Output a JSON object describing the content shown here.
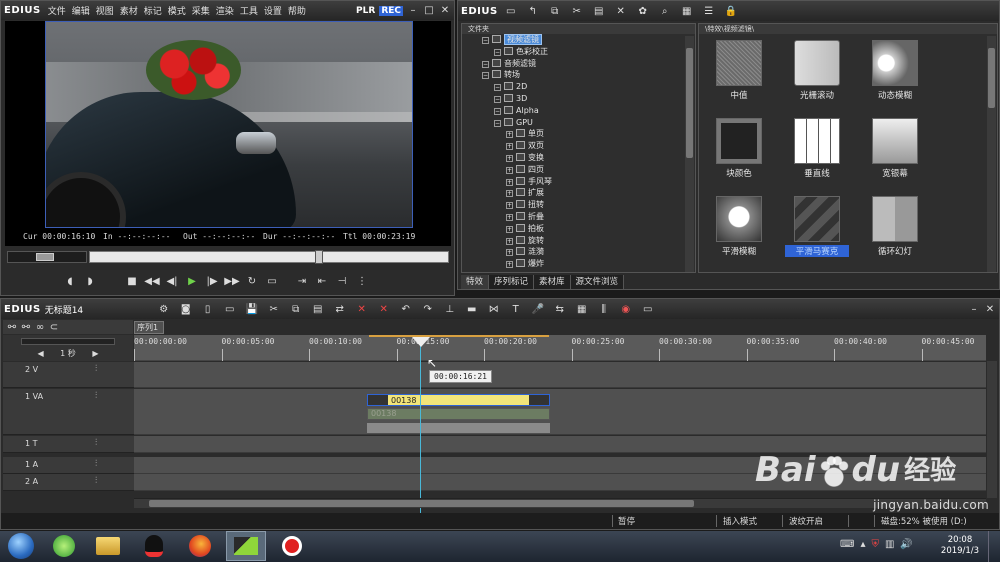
{
  "player": {
    "logo": "EDIUS",
    "menu": [
      "文件",
      "编辑",
      "视图",
      "素材",
      "标记",
      "模式",
      "采集",
      "渲染",
      "工具",
      "设置",
      "帮助"
    ],
    "plr": "PLR",
    "rec": "REC",
    "cur_label": "Cur",
    "cur_value": "00:00:16:10",
    "in_label": "In",
    "in_value": "--:--:--:--",
    "out_label": "Out",
    "out_value": "--:--:--:--",
    "dur_label": "Dur",
    "dur_value": "--:--:--:--",
    "ttl_label": "Ttl",
    "ttl_value": "00:00:23:19"
  },
  "bin": {
    "logo": "EDIUS",
    "tree_header": "文件夹",
    "path": "\\特效\\视频滤镜\\",
    "tree": [
      {
        "label": "视频滤镜",
        "level": 1,
        "selected": true
      },
      {
        "label": "色彩校正",
        "level": 2
      },
      {
        "label": "音频滤镜",
        "level": 1
      },
      {
        "label": "转场",
        "level": 1
      },
      {
        "label": "2D",
        "level": 2
      },
      {
        "label": "3D",
        "level": 2
      },
      {
        "label": "Alpha",
        "level": 2
      },
      {
        "label": "GPU",
        "level": 2
      },
      {
        "label": "单页",
        "level": 3
      },
      {
        "label": "双页",
        "level": 3
      },
      {
        "label": "变换",
        "level": 3
      },
      {
        "label": "四页",
        "level": 3
      },
      {
        "label": "手风琴",
        "level": 3
      },
      {
        "label": "扩展",
        "level": 3
      },
      {
        "label": "扭转",
        "level": 3
      },
      {
        "label": "折叠",
        "level": 3
      },
      {
        "label": "拍板",
        "level": 3
      },
      {
        "label": "旋转",
        "level": 3
      },
      {
        "label": "涟漪",
        "level": 3
      },
      {
        "label": "爆炸",
        "level": 3
      }
    ],
    "effects": [
      "中值",
      "光栅滚动",
      "动态模糊",
      "块颜色",
      "垂直线",
      "宽银幕",
      "平滑模糊",
      "平滑马赛克",
      "循环幻灯"
    ],
    "selected_effect": "平滑马赛克",
    "tabs": [
      "特效",
      "序列标记",
      "素材库",
      "源文件浏览"
    ]
  },
  "timeline": {
    "logo": "EDIUS",
    "project": "无标题14",
    "sequence_tab": "序列1",
    "scale": "1 秒",
    "ruler": [
      "00:00:00:00",
      "00:00:05:00",
      "00:00:10:00",
      "00:00:15:00",
      "00:00:20:00",
      "00:00:25:00",
      "00:00:30:00",
      "00:00:35:00",
      "00:00:40:00",
      "00:00:45:00"
    ],
    "tooltip": "00:00:16:21",
    "tracks": [
      "2 V",
      "1 VA",
      "1 T",
      "1 A",
      "2 A"
    ],
    "clip_name": "00138",
    "clip_ghost": "00138"
  },
  "status": {
    "pause": "暂停",
    "insert": "插入模式",
    "ripple": "波纹开启",
    "disk": "磁盘:52% 被使用 (D:)"
  },
  "taskbar": {
    "time": "20:08",
    "date": "2019/1/3"
  },
  "watermark": {
    "brand": "Bai",
    "brand2": "du",
    "cn": "经验",
    "url": "jingyan.baidu.com"
  },
  "colors": {
    "accent": "#4a8ad8",
    "playhead": "#49b8d8",
    "clip": "#f2e57a",
    "rec": "#2f64d6"
  }
}
